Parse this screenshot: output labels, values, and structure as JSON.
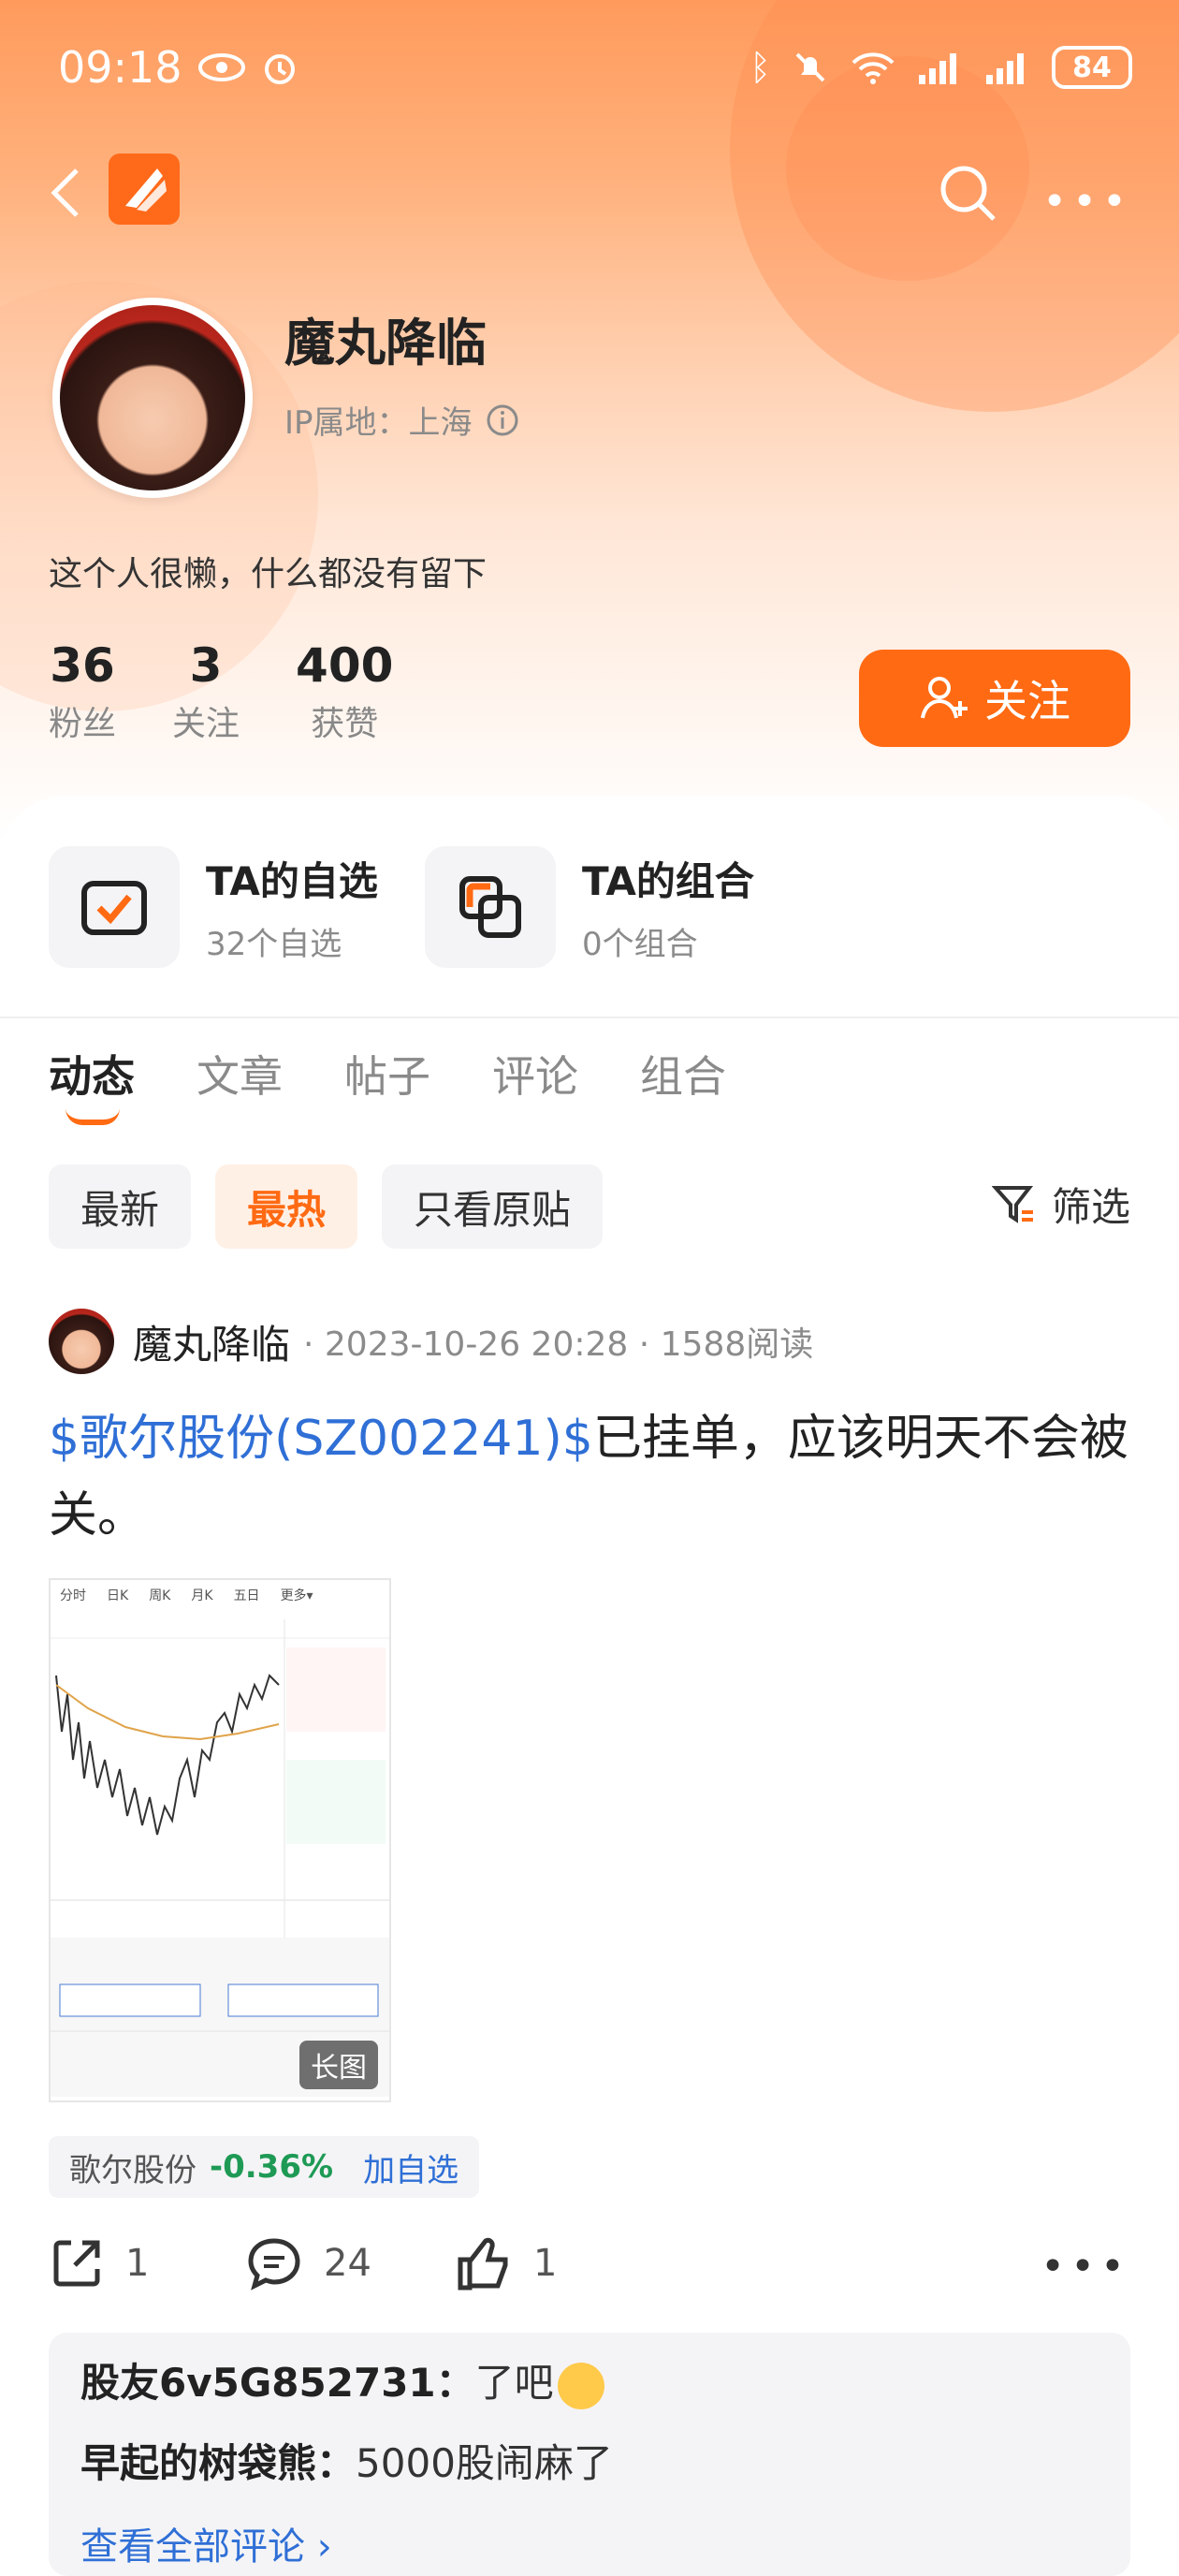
{
  "status_bar": {
    "time": "09:18",
    "battery": "84"
  },
  "profile": {
    "name": "魔丸降临",
    "ip_location": "IP属地：上海",
    "bio": "这个人很懒，什么都没有留下",
    "stats": [
      {
        "value": "36",
        "label": "粉丝"
      },
      {
        "value": "3",
        "label": "关注"
      },
      {
        "value": "400",
        "label": "获赞"
      }
    ],
    "follow_label": "关注"
  },
  "features": {
    "watchlist": {
      "title": "TA的自选",
      "sub": "32个自选"
    },
    "portfolio": {
      "title": "TA的组合",
      "sub": "0个组合"
    }
  },
  "tabs": [
    "动态",
    "文章",
    "帖子",
    "评论",
    "组合"
  ],
  "chips": [
    "最新",
    "最热",
    "只看原贴"
  ],
  "filter_label": "筛选",
  "post": {
    "author": "魔丸降临",
    "meta": "· 2023-10-26 20:28 · 1588阅读",
    "tag_text": "$歌尔股份(SZ002241)$",
    "body": "已挂单，应该明天不会被关。",
    "image_tag": "长图",
    "image_tabs": [
      "分时",
      "日K",
      "周K",
      "月K",
      "五日",
      "更多▾"
    ],
    "stock": {
      "name": "歌尔股份",
      "change": "-0.36%",
      "add": "加自选"
    },
    "actions": {
      "share": "1",
      "comment": "24",
      "like": "1"
    }
  },
  "comments": [
    {
      "user": "股友6v5G852731",
      "sep": "：",
      "text": "了吧"
    },
    {
      "user": "早起的树袋熊",
      "sep": "：",
      "text": "5000股闹麻了"
    }
  ],
  "view_all": "查看全部评论 ›",
  "colors": {
    "accent": "#ff6a13",
    "link": "#2f6fd6",
    "down": "#1e9a55"
  }
}
